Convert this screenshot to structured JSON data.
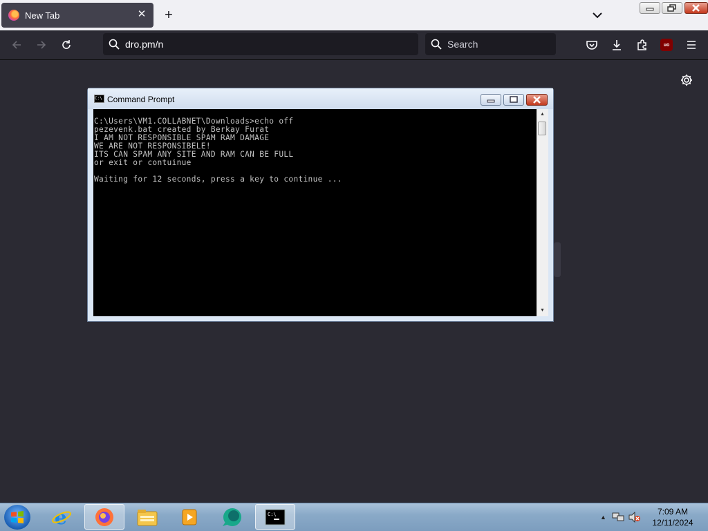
{
  "browser": {
    "tab": {
      "title": "New Tab"
    },
    "url": "dro.pm/n",
    "search_placeholder": "Search",
    "extension_badge": "uo"
  },
  "cmd": {
    "title": "Command Prompt",
    "icon_text": "C:\\",
    "lines": [
      "C:\\Users\\VM1.COLLABNET\\Downloads>echo off",
      "pezevenk.bat created by Berkay Furat",
      "I AM NOT RESPONSIBLE SPAM RAM DAMAGE",
      "WE ARE NOT RESPONSIBELE!",
      "ITS CAN SPAM ANY SITE AND RAM CAN BE FULL",
      "or exit or contuinue",
      "",
      "Waiting for 12 seconds, press a key to continue ..."
    ]
  },
  "taskbar": {
    "items": [
      "start-button",
      "internet-explorer",
      "firefox",
      "file-explorer",
      "media-player",
      "app-green",
      "command-prompt"
    ],
    "time": "7:09 AM",
    "date": "12/11/2024"
  }
}
